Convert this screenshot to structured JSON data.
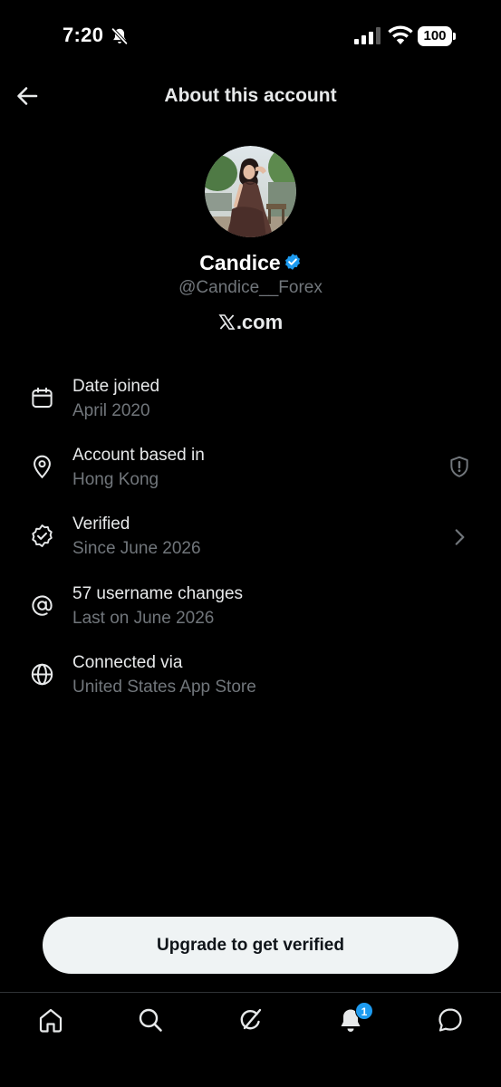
{
  "status_bar": {
    "time": "7:20",
    "battery": "100",
    "icons": [
      "bell-off-icon",
      "signal-icon",
      "wifi-icon",
      "battery-icon"
    ]
  },
  "header": {
    "title": "About this account",
    "back_icon": "arrow-left-icon"
  },
  "profile": {
    "display_name": "Candice",
    "username": "@Candice__Forex",
    "connection": ".com",
    "connection_icon": "x-logo-icon",
    "verified_badge_color": "#1d9bf0"
  },
  "info_items": [
    {
      "icon": "calendar-icon",
      "label": "Date joined",
      "value": "April 2020"
    },
    {
      "icon": "location-pin-icon",
      "label": "Account based in",
      "value": "Hong Kong",
      "trailing_icon": "shield-alert-icon"
    },
    {
      "icon": "verified-seal-icon",
      "label": "Verified",
      "value": "Since June 2026",
      "trailing_icon": "chevron-right-icon"
    },
    {
      "icon": "at-sign-icon",
      "label": "57 username changes",
      "value": "Last on June 2026"
    },
    {
      "icon": "globe-icon",
      "label": "Connected via",
      "value": "United States App Store"
    }
  ],
  "cta": {
    "label": "Upgrade to get verified"
  },
  "tab_bar": {
    "tabs": [
      "home-icon",
      "search-icon",
      "grok-icon",
      "notifications-icon",
      "messages-icon"
    ],
    "notification_count": "1",
    "accent_color": "#1d9bf0"
  },
  "colors": {
    "background": "#000000",
    "primary_text": "#e7e9ea",
    "secondary_text": "#71767b",
    "button_bg": "#eff3f4"
  }
}
